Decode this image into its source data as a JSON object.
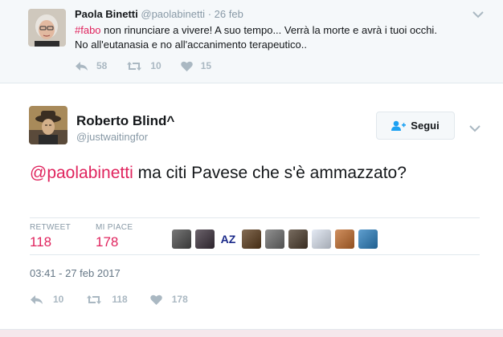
{
  "parent_tweet": {
    "author_name": "Paola Binetti",
    "handle": "@paolabinetti",
    "separator": "·",
    "date": "26 feb",
    "hashtag": "#fabo",
    "text_line1": " non rinunciare a vivere! A suo tempo... Verrà la morte e avrà i tuoi occhi.",
    "text_line2": "No all'eutanasia e no all'accanimento terapeutico..",
    "reply_count": "58",
    "retweet_count": "10",
    "like_count": "15"
  },
  "main_tweet": {
    "author_name": "Roberto Blind^",
    "handle": "@justwaitingfor",
    "follow_label": "Segui",
    "mention": "@paolabinetti",
    "text": " ma citi Pavese che s'è ammazzato?",
    "retweet_label": "RETWEET",
    "retweet_value": "118",
    "like_label": "MI PIACE",
    "like_value": "178",
    "timestamp": "03:41 - 27 feb 2017",
    "reply_count": "10",
    "retweet_count": "118",
    "like_count": "178"
  },
  "likers": [
    {
      "icon": "liker-avatar-1",
      "color": "#4a4a4a"
    },
    {
      "icon": "liker-avatar-2",
      "color": "#3a2f3a"
    },
    {
      "icon": "liker-avatar-az",
      "color": "#ffffff",
      "label": "AZ"
    },
    {
      "icon": "liker-avatar-4",
      "color": "#5a3a1a"
    },
    {
      "icon": "liker-avatar-5",
      "color": "#6b6b6b"
    },
    {
      "icon": "liker-avatar-6",
      "color": "#4b3b2b"
    },
    {
      "icon": "liker-avatar-7",
      "color": "#dbe3f0"
    },
    {
      "icon": "liker-avatar-8",
      "color": "#c06a2a"
    },
    {
      "icon": "liker-avatar-9",
      "color": "#2a7fbf"
    }
  ],
  "colors": {
    "accent_red": "#e0245e",
    "muted_text": "#8899a6",
    "action_icon": "#aab8c2",
    "border": "#e1e8ed",
    "follow_blue": "#1da1f2"
  }
}
